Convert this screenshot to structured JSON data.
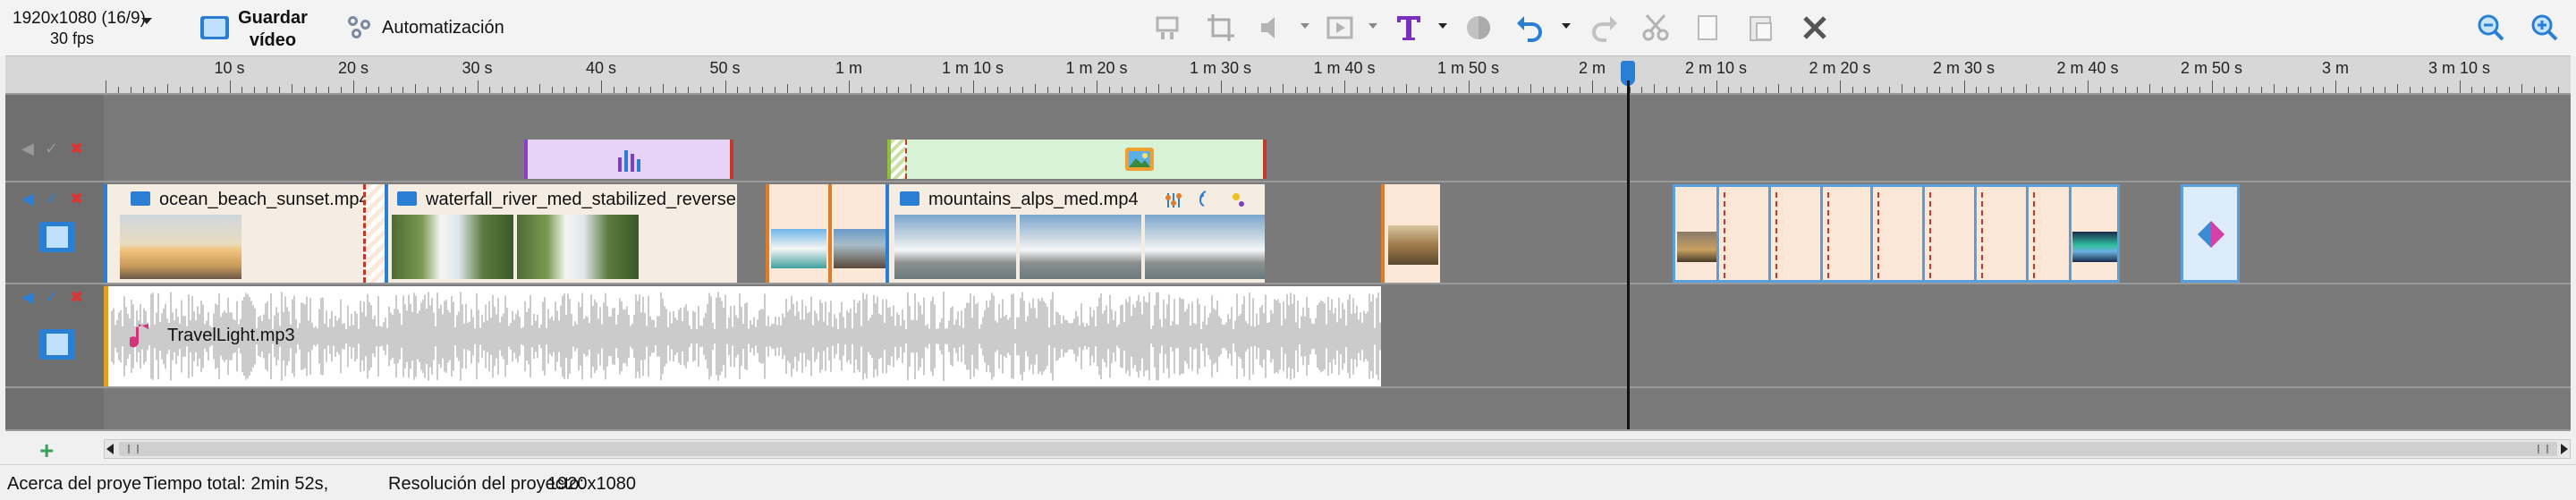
{
  "toolbar": {
    "resolution": "1920x1080 (16/9)",
    "fps": "30 fps",
    "save_line1": "Guardar",
    "save_line2": "vídeo",
    "automation": "Automatización",
    "icons": [
      "split-icon",
      "crop-icon",
      "volume-icon",
      "transition-icon",
      "text-icon",
      "color-icon",
      "undo-icon",
      "redo-icon",
      "cut-icon",
      "copy-icon",
      "paste-icon",
      "delete-icon",
      "zoom-out-icon",
      "zoom-in-icon"
    ]
  },
  "ruler": {
    "labels": [
      "10 s",
      "20 s",
      "30 s",
      "40 s",
      "50 s",
      "1 m",
      "1 m 10 s",
      "1 m 20 s",
      "1 m 30 s",
      "1 m 40 s",
      "1 m 50 s",
      "2 m",
      "2 m 10 s",
      "2 m 20 s",
      "2 m 30 s",
      "2 m 40 s",
      "2 m 50 s",
      "3 m",
      "3 m 10 s"
    ]
  },
  "tracks": {
    "video_clip_1": "ocean_beach_sunset.mp4",
    "video_clip_2": "waterfall_river_med_stabilized_reverse...",
    "video_clip_3": "mountains_alps_med.mp4",
    "audio_clip": "TravelLight.mp3"
  },
  "status": {
    "about": "Acerca del proye",
    "total_time": "Tiempo total: 2min 52s,",
    "resolution_label": "Resolución del proyecto:",
    "resolution_value": "1920x1080"
  },
  "colors": {
    "accent": "#2a7fd4",
    "effect_clip": "#e7d3f5",
    "image_clip": "#d8f2d6",
    "video_clip_bg": "#f5ece2",
    "transition_clip": "#fde7d6"
  }
}
